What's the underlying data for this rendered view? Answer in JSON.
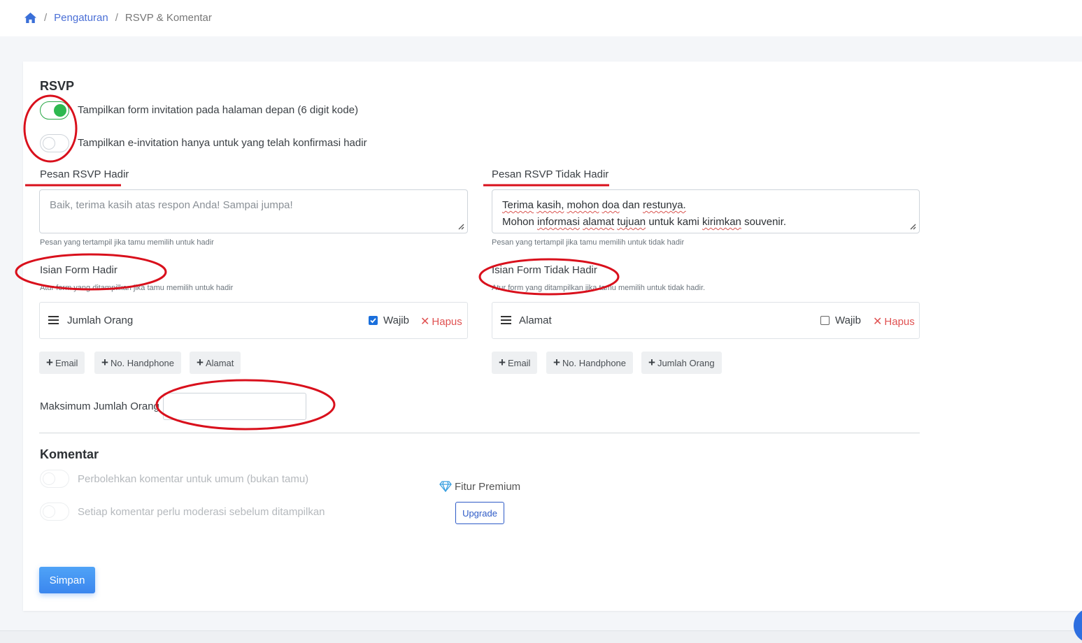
{
  "breadcrumb": {
    "home_icon": "home-icon",
    "items": [
      "Pengaturan",
      "RSVP & Komentar"
    ]
  },
  "rsvp": {
    "title": "RSVP",
    "toggle1": {
      "label": "Tampilkan form invitation pada halaman depan (6 digit kode)",
      "on": true
    },
    "toggle2": {
      "label": "Tampilkan e-invitation hanya untuk yang telah konfirmasi hadir",
      "on": false
    }
  },
  "hadir": {
    "message_label": "Pesan RSVP Hadir",
    "message_placeholder": "Baik, terima kasih atas respon Anda! Sampai jumpa!",
    "message_help": "Pesan yang tertampil jika tamu memilih untuk hadir",
    "form_title": "Isian Form Hadir",
    "form_help": "Atur form yang ditampilkan jika tamu memilih untuk hadir",
    "field": {
      "name": "Jumlah Orang",
      "required_label": "Wajib",
      "required": true,
      "delete_label": "Hapus"
    },
    "add_buttons": [
      "Email",
      "No. Handphone",
      "Alamat"
    ]
  },
  "tidak_hadir": {
    "message_label": "Pesan RSVP Tidak Hadir",
    "message_line1_words": [
      "Terima",
      "kasih,",
      "mohon",
      "doa",
      "dan",
      "restunya."
    ],
    "message_line2_words": [
      "Mohon",
      "informasi",
      "alamat",
      "tujuan",
      "untuk kami",
      "kirimkan",
      "souvenir."
    ],
    "message_help": "Pesan yang tertampil jika tamu memilih untuk tidak hadir",
    "form_title": "Isian Form Tidak Hadir",
    "form_help": "Atur form yang ditampilkan jika tamu memilih untuk tidak hadir.",
    "field": {
      "name": "Alamat",
      "required_label": "Wajib",
      "required": false,
      "delete_label": "Hapus"
    },
    "add_buttons": [
      "Email",
      "No. Handphone",
      "Jumlah Orang"
    ]
  },
  "max_people": {
    "label": "Maksimum Jumlah Orang",
    "value": ""
  },
  "komentar": {
    "title": "Komentar",
    "toggle1": "Perbolehkan komentar untuk umum (bukan tamu)",
    "toggle2": "Setiap komentar perlu moderasi sebelum ditampilkan",
    "premium_label": "Fitur Premium",
    "upgrade_label": "Upgrade"
  },
  "save_label": "Simpan",
  "colors": {
    "accent": "#4a6fd6",
    "toggle_on": "#2db84f",
    "danger": "#e05252",
    "annotation": "#d9101c",
    "primary_button": "#3b86ee"
  }
}
